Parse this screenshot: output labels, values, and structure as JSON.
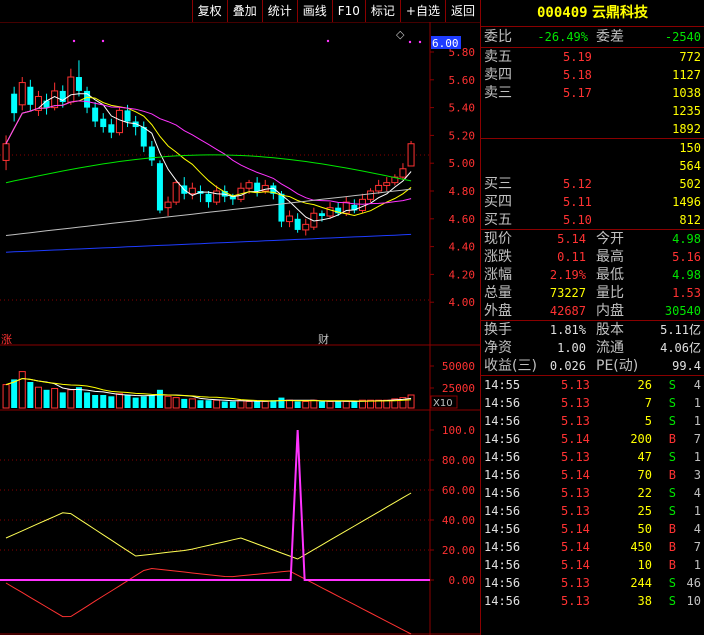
{
  "toolbar": [
    "复权",
    "叠加",
    "统计",
    "画线",
    "F10",
    "标记",
    "+自选",
    "返回"
  ],
  "chart": {
    "current_price_tag": "6.00",
    "price_ticks": [
      "5.80",
      "5.60",
      "5.40",
      "5.20",
      "5.00",
      "4.80",
      "4.60",
      "4.40",
      "4.20",
      "4.00"
    ],
    "markers": {
      "rise": "涨",
      "finance": "财"
    },
    "diamond": "◇",
    "volume_ticks": [
      "50000",
      "25000"
    ],
    "volume_unit": "X10",
    "osc_ticks": [
      "100.0",
      "80.00",
      "60.00",
      "40.00",
      "20.00",
      "0.00"
    ]
  },
  "stock": {
    "code": "000409",
    "name": "云鼎科技"
  },
  "commission": {
    "ratio_label": "委比",
    "ratio": "-26.49%",
    "diff_label": "委差",
    "diff": "-2540"
  },
  "asks": [
    {
      "label": "卖五",
      "price": "5.19",
      "vol": "772"
    },
    {
      "label": "卖四",
      "price": "5.18",
      "vol": "1127"
    },
    {
      "label": "卖三",
      "price": "5.17",
      "vol": "1038"
    },
    {
      "label": "",
      "price": "",
      "vol": "1235"
    },
    {
      "label": "",
      "price": "",
      "vol": "1892"
    }
  ],
  "bids": [
    {
      "label": "",
      "price": "",
      "vol": "150"
    },
    {
      "label": "",
      "price": "",
      "vol": "564"
    },
    {
      "label": "买三",
      "price": "5.12",
      "vol": "502"
    },
    {
      "label": "买四",
      "price": "5.11",
      "vol": "1496"
    },
    {
      "label": "买五",
      "price": "5.10",
      "vol": "812"
    }
  ],
  "quote": [
    {
      "l1": "现价",
      "v1": "5.14",
      "c1": "red",
      "l2": "今开",
      "v2": "4.98",
      "c2": "grn"
    },
    {
      "l1": "涨跌",
      "v1": "0.11",
      "c1": "red",
      "l2": "最高",
      "v2": "5.16",
      "c2": "red"
    },
    {
      "l1": "涨幅",
      "v1": "2.19%",
      "c1": "red",
      "l2": "最低",
      "v2": "4.98",
      "c2": "grn"
    },
    {
      "l1": "总量",
      "v1": "73227",
      "c1": "yel",
      "l2": "量比",
      "v2": "1.53",
      "c2": "red"
    },
    {
      "l1": "外盘",
      "v1": "42687",
      "c1": "red",
      "l2": "内盘",
      "v2": "30540",
      "c2": "grn"
    }
  ],
  "fundamentals": [
    {
      "l1": "换手",
      "v1": "1.81%",
      "l2": "股本",
      "v2": "5.11亿"
    },
    {
      "l1": "净资",
      "v1": "1.00",
      "l2": "流通",
      "v2": "4.06亿"
    },
    {
      "l1": "收益(三)",
      "v1": "0.026",
      "l2": "PE(动)",
      "v2": "99.4"
    }
  ],
  "ticks": [
    {
      "time": "14:55",
      "price": "5.13",
      "vol": "26",
      "side": "S",
      "n": "4"
    },
    {
      "time": "14:56",
      "price": "5.13",
      "vol": "7",
      "side": "S",
      "n": "1"
    },
    {
      "time": "14:56",
      "price": "5.13",
      "vol": "5",
      "side": "S",
      "n": "1"
    },
    {
      "time": "14:56",
      "price": "5.14",
      "vol": "200",
      "side": "B",
      "n": "7"
    },
    {
      "time": "14:56",
      "price": "5.13",
      "vol": "47",
      "side": "S",
      "n": "1"
    },
    {
      "time": "14:56",
      "price": "5.14",
      "vol": "70",
      "side": "B",
      "n": "3"
    },
    {
      "time": "14:56",
      "price": "5.13",
      "vol": "22",
      "side": "S",
      "n": "4"
    },
    {
      "time": "14:56",
      "price": "5.13",
      "vol": "25",
      "side": "S",
      "n": "1"
    },
    {
      "time": "14:56",
      "price": "5.14",
      "vol": "50",
      "side": "B",
      "n": "4"
    },
    {
      "time": "14:56",
      "price": "5.14",
      "vol": "450",
      "side": "B",
      "n": "7"
    },
    {
      "time": "14:56",
      "price": "5.14",
      "vol": "10",
      "side": "B",
      "n": "1"
    },
    {
      "time": "14:56",
      "price": "5.13",
      "vol": "244",
      "side": "S",
      "n": "46"
    },
    {
      "time": "14:56",
      "price": "5.13",
      "vol": "38",
      "side": "S",
      "n": "10"
    }
  ],
  "candles": [
    [
      5.02,
      5.14,
      5.2,
      4.95
    ],
    [
      5.5,
      5.36,
      5.55,
      5.3
    ],
    [
      5.42,
      5.58,
      5.62,
      5.38
    ],
    [
      5.55,
      5.42,
      5.6,
      5.38
    ],
    [
      5.38,
      5.48,
      5.52,
      5.34
    ],
    [
      5.45,
      5.4,
      5.5,
      5.35
    ],
    [
      5.4,
      5.52,
      5.58,
      5.38
    ],
    [
      5.52,
      5.44,
      5.56,
      5.4
    ],
    [
      5.44,
      5.62,
      5.68,
      5.42
    ],
    [
      5.62,
      5.52,
      5.74,
      5.48
    ],
    [
      5.52,
      5.4,
      5.55,
      5.36
    ],
    [
      5.4,
      5.3,
      5.44,
      5.26
    ],
    [
      5.32,
      5.26,
      5.36,
      5.22
    ],
    [
      5.28,
      5.22,
      5.32,
      5.18
    ],
    [
      5.22,
      5.38,
      5.4,
      5.2
    ],
    [
      5.38,
      5.3,
      5.42,
      5.26
    ],
    [
      5.3,
      5.26,
      5.34,
      5.2
    ],
    [
      5.26,
      5.12,
      5.3,
      5.08
    ],
    [
      5.12,
      5.02,
      5.16,
      4.98
    ],
    [
      5.0,
      4.66,
      5.02,
      4.64
    ],
    [
      4.68,
      4.72,
      4.76,
      4.62
    ],
    [
      4.72,
      4.86,
      4.88,
      4.7
    ],
    [
      4.84,
      4.78,
      4.9,
      4.74
    ],
    [
      4.78,
      4.82,
      4.86,
      4.74
    ],
    [
      4.8,
      4.78,
      4.84,
      4.72
    ],
    [
      4.78,
      4.72,
      4.8,
      4.68
    ],
    [
      4.72,
      4.8,
      4.84,
      4.7
    ],
    [
      4.8,
      4.76,
      4.84,
      4.72
    ],
    [
      4.76,
      4.74,
      4.78,
      4.7
    ],
    [
      4.74,
      4.82,
      4.86,
      4.72
    ],
    [
      4.82,
      4.86,
      4.88,
      4.78
    ],
    [
      4.86,
      4.8,
      4.9,
      4.76
    ],
    [
      4.8,
      4.84,
      4.88,
      4.78
    ],
    [
      4.84,
      4.78,
      4.86,
      4.74
    ],
    [
      4.78,
      4.58,
      4.8,
      4.54
    ],
    [
      4.58,
      4.62,
      4.66,
      4.54
    ],
    [
      4.6,
      4.52,
      4.64,
      4.5
    ],
    [
      4.52,
      4.56,
      4.6,
      4.48
    ],
    [
      4.54,
      4.64,
      4.68,
      4.52
    ],
    [
      4.64,
      4.62,
      4.66,
      4.58
    ],
    [
      4.62,
      4.68,
      4.72,
      4.6
    ],
    [
      4.68,
      4.64,
      4.72,
      4.62
    ],
    [
      4.64,
      4.72,
      4.76,
      4.62
    ],
    [
      4.7,
      4.66,
      4.74,
      4.64
    ],
    [
      4.66,
      4.74,
      4.78,
      4.64
    ],
    [
      4.74,
      4.8,
      4.82,
      4.72
    ],
    [
      4.8,
      4.84,
      4.88,
      4.78
    ],
    [
      4.84,
      4.86,
      4.9,
      4.8
    ],
    [
      4.86,
      4.9,
      4.92,
      4.84
    ],
    [
      4.9,
      4.96,
      5.0,
      4.88
    ],
    [
      4.98,
      5.14,
      5.16,
      4.98
    ]
  ],
  "volumes": [
    18,
    22,
    28,
    20,
    16,
    14,
    15,
    12,
    14,
    16,
    12,
    10,
    10,
    9,
    11,
    10,
    8,
    9,
    10,
    14,
    9,
    8,
    7,
    7,
    6,
    6,
    6,
    5,
    5,
    6,
    5,
    5,
    5,
    6,
    8,
    6,
    5,
    5,
    6,
    5,
    5,
    5,
    5,
    5,
    6,
    6,
    6,
    6,
    7,
    8,
    10
  ]
}
